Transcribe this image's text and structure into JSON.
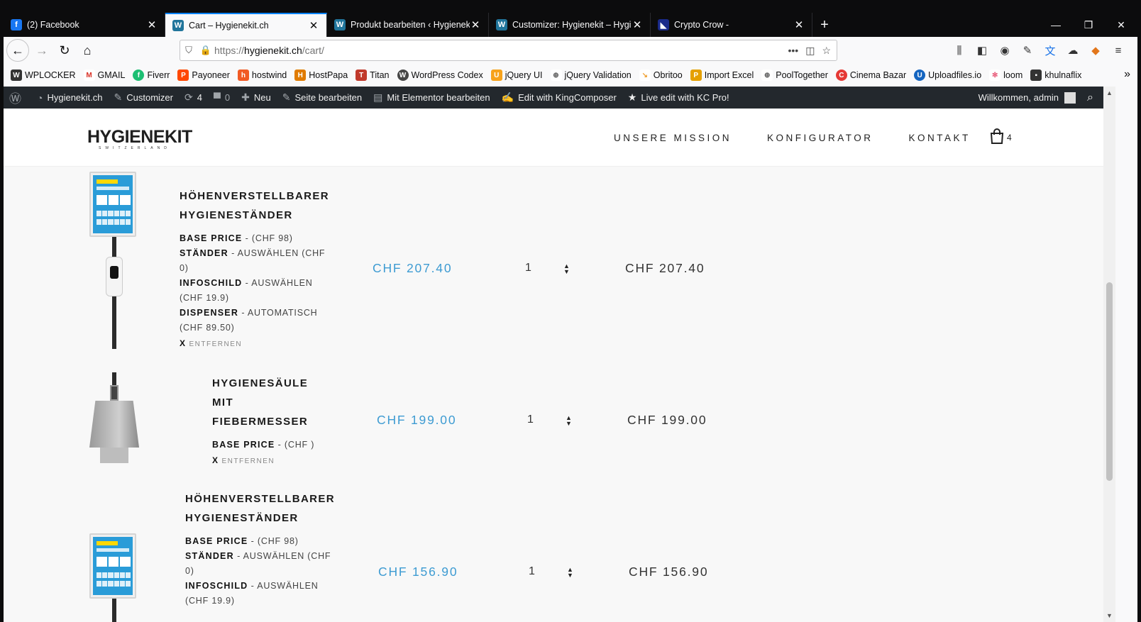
{
  "tabs": [
    {
      "title": "(2) Facebook",
      "icon": "facebook-icon",
      "color": "#1877f2",
      "glyph": "f"
    },
    {
      "title": "Cart – Hygienekit.ch",
      "icon": "wordpress-icon",
      "color": "#21759b",
      "glyph": "W"
    },
    {
      "title": "Produkt bearbeiten ‹ Hygienek",
      "icon": "wordpress-icon",
      "color": "#21759b",
      "glyph": "W"
    },
    {
      "title": "Customizer: Hygienekit – Hygi",
      "icon": "wordpress-icon",
      "color": "#21759b",
      "glyph": "W"
    },
    {
      "title": "Crypto Crow -",
      "icon": "crypto-crow-icon",
      "color": "#1a2a8a",
      "glyph": "◣"
    }
  ],
  "url": {
    "prefix": "https://",
    "host": "hygienekit.ch",
    "path": "/cart/"
  },
  "bookmarks": [
    {
      "label": "WPLOCKER",
      "color": "#333",
      "glyph": "W"
    },
    {
      "label": "GMAIL",
      "color": "#d93025",
      "glyph": "M"
    },
    {
      "label": "Fiverr",
      "color": "#1dbf73",
      "glyph": "f"
    },
    {
      "label": "Payoneer",
      "color": "#ff4800",
      "glyph": "P"
    },
    {
      "label": "hostwind",
      "color": "#f15a24",
      "glyph": "h"
    },
    {
      "label": "HostPapa",
      "color": "#e07b00",
      "glyph": "H"
    },
    {
      "label": "Titan",
      "color": "#c0392b",
      "glyph": "T"
    },
    {
      "label": "WordPress Codex",
      "color": "#464646",
      "glyph": "W"
    },
    {
      "label": "jQuery UI",
      "color": "#f7a21b",
      "glyph": "U"
    },
    {
      "label": "jQuery Validation",
      "color": "#555",
      "glyph": "⊕"
    },
    {
      "label": "Obritoo",
      "color": "#f0a030",
      "glyph": "o"
    },
    {
      "label": "Import Excel",
      "color": "#e5a000",
      "glyph": "P"
    },
    {
      "label": "PoolTogether",
      "color": "#555",
      "glyph": "⊕"
    },
    {
      "label": "Cinema Bazar",
      "color": "#e53935",
      "glyph": "C"
    },
    {
      "label": "Uploadfiles.io",
      "color": "#1565c0",
      "glyph": "U"
    },
    {
      "label": "loom",
      "color": "#e85c7a",
      "glyph": "✻"
    },
    {
      "label": "khulnaflix",
      "color": "#333",
      "glyph": "■"
    }
  ],
  "adminbar": {
    "site": "Hygienekit.ch",
    "customizer": "Customizer",
    "updates": "4",
    "comments": "0",
    "new": "Neu",
    "edit_page": "Seite bearbeiten",
    "elementor": "Mit Elementor bearbeiten",
    "kingcomposer": "Edit with KingComposer",
    "kc_pro": "Live edit with KC Pro!",
    "welcome": "Willkommen, admin"
  },
  "site": {
    "logo": "HYGIENEKIT",
    "logo_sub": "SWITZERLAND",
    "menu": [
      "UNSERE MISSION",
      "KONFIGURATOR",
      "KONTAKT"
    ],
    "cart_count": "4"
  },
  "cart": {
    "items": [
      {
        "name_lines": [
          "HÖHENVERSTELLBARER",
          "HYGIENESTÄNDER"
        ],
        "options": [
          {
            "key": "BASE PRICE",
            "value": " - (CHF 98)"
          },
          {
            "key": "STÄNDER",
            "value": " - AUSWÄHLEN (CHF 0)"
          },
          {
            "key": "INFOSCHILD",
            "value": " - AUSWÄHLEN (CHF 19.9)"
          },
          {
            "key": "DISPENSER",
            "value": " - AUTOMATISCH (CHF 89.50)"
          }
        ],
        "remove": "ENTFERNEN",
        "price": "CHF 207.40",
        "qty": "1",
        "total": "CHF 207.40"
      },
      {
        "name_lines": [
          "HYGIENESÄULE",
          "MIT",
          "FIEBERMESSER"
        ],
        "options": [
          {
            "key": "BASE PRICE",
            "value": " - (CHF )"
          }
        ],
        "remove": "ENTFERNEN",
        "price": "CHF 199.00",
        "qty": "1",
        "total": "CHF 199.00"
      },
      {
        "name_lines": [
          "HÖHENVERSTELLBARER",
          "HYGIENESTÄNDER"
        ],
        "options": [
          {
            "key": "BASE PRICE",
            "value": " - (CHF 98)"
          },
          {
            "key": "STÄNDER",
            "value": " - AUSWÄHLEN (CHF 0)"
          },
          {
            "key": "INFOSCHILD",
            "value": " - AUSWÄHLEN (CHF 19.9)"
          }
        ],
        "remove": "",
        "price": "CHF 156.90",
        "qty": "1",
        "total": "CHF 156.90"
      }
    ]
  },
  "colors": {
    "accent": "#3d9bd2",
    "adminbar": "#23282d",
    "tab_active_border": "#0a84ff"
  }
}
